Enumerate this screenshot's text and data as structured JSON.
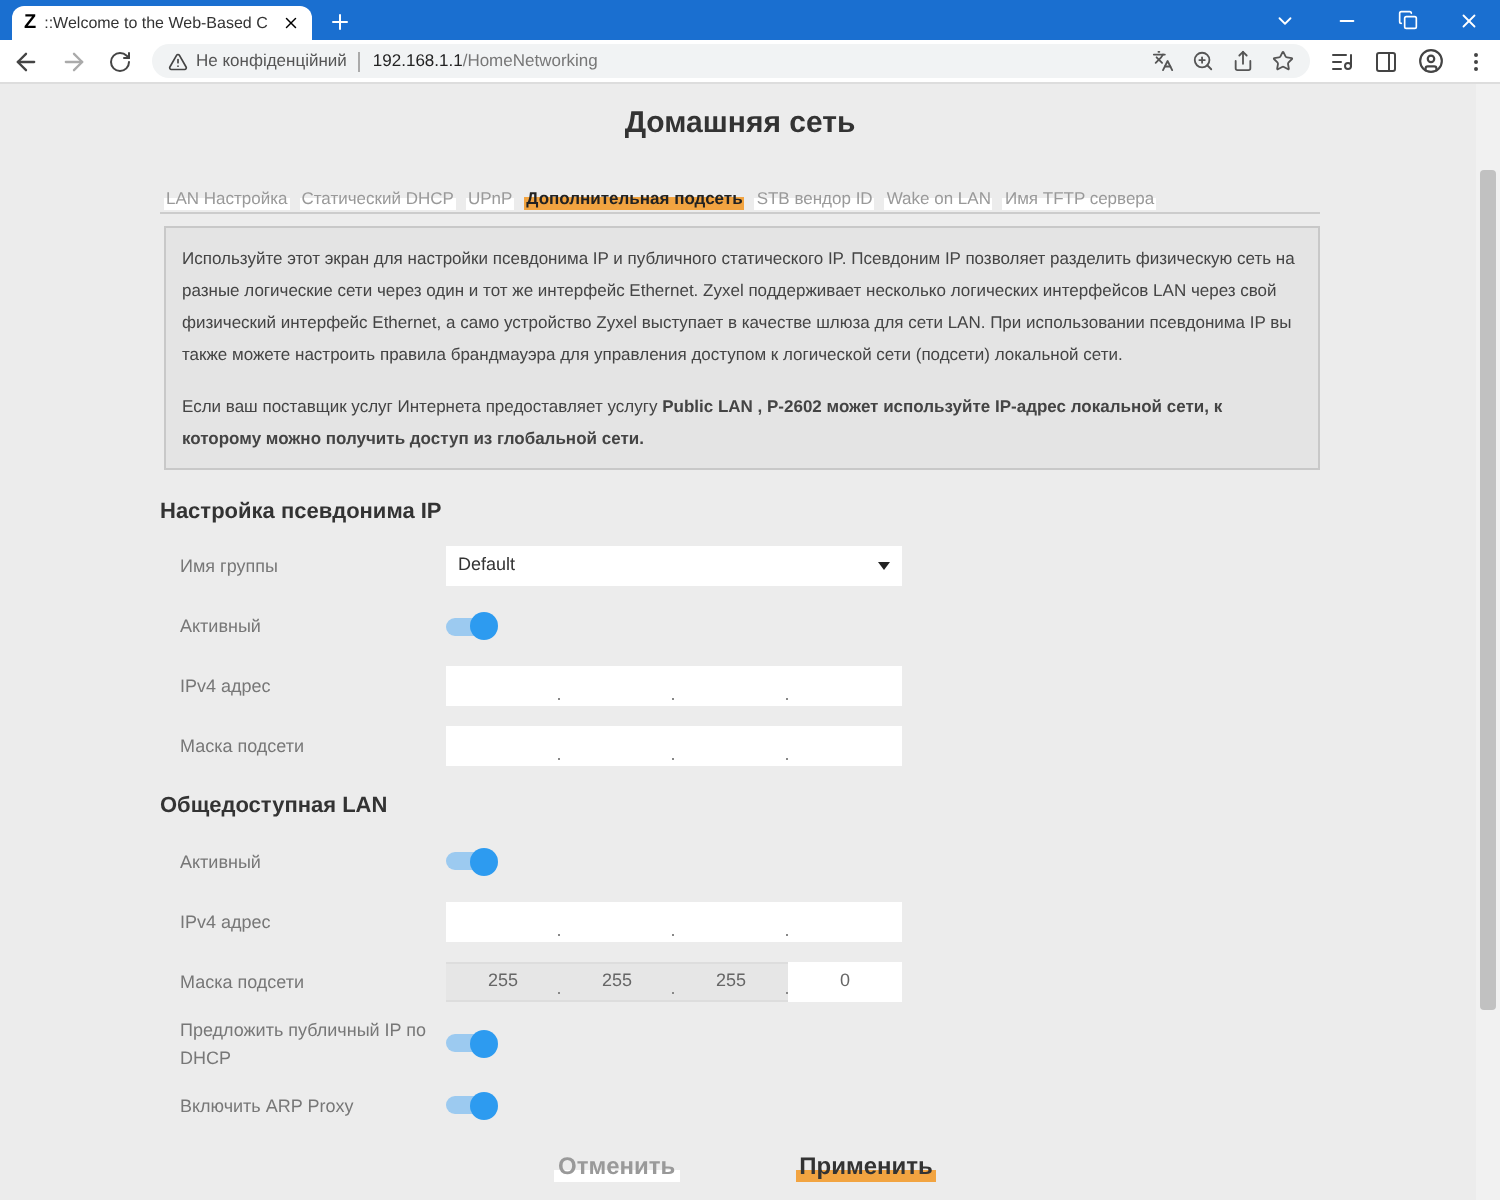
{
  "browser": {
    "tab": {
      "logo": "Z",
      "title": "::Welcome to the Web-Based C"
    },
    "security": "Не конфіденційний",
    "url_host": "192.168.1.1",
    "url_path": "/HomeNetworking"
  },
  "page_title": "Домашняя сеть",
  "tabs": [
    {
      "label": "LAN Настройка",
      "selected": false
    },
    {
      "label": "Статический DHCP",
      "selected": false
    },
    {
      "label": "UPnP",
      "selected": false
    },
    {
      "label": "Дополнительная подсеть",
      "selected": true
    },
    {
      "label": "STB вендор ID",
      "selected": false
    },
    {
      "label": "Wake on LAN",
      "selected": false
    },
    {
      "label": "Имя TFTP сервера",
      "selected": false
    }
  ],
  "info": [
    "Используйте этот экран для настройки псевдонима IP и публичного статического IP. Псевдоним IP позволяет разделить физическую сеть на разные логические сети через один и тот же интерфейс Ethernet. Zyxel поддерживает несколько логических интерфейсов LAN через свой физический интерфейс Ethernet, а само устройство Zyxel выступает в качестве шлюза для сети LAN. При использовании псевдонима IP вы также можете настроить правила брандмауэра для управления доступом к логической сети (подсети) локальной сети.",
    "Если ваш поставщик услуг Интернета предоставляет услугу **Public LAN , P-2602 может используйте IP-адрес локальной сети, к которому можно получить доступ из глобальной сети.**"
  ],
  "sections": [
    {
      "title": "Настройка псевдонима IP",
      "rows": [
        {
          "kind": "select",
          "label": "Имя группы",
          "value": "Default"
        },
        {
          "kind": "toggle",
          "label": "Активный",
          "on": true
        },
        {
          "kind": "ip",
          "label": "IPv4 адрес",
          "octets": [
            {
              "disabled": false
            },
            {
              "disabled": false
            },
            {
              "disabled": false
            },
            {
              "disabled": false
            }
          ]
        },
        {
          "kind": "ip",
          "label": "Маска подсети",
          "octets": [
            {
              "disabled": false
            },
            {
              "disabled": false
            },
            {
              "disabled": false
            },
            {
              "disabled": false
            }
          ]
        }
      ]
    },
    {
      "title": "Общедоступная LAN",
      "rows": [
        {
          "kind": "toggle",
          "label": "Активный",
          "on": true
        },
        {
          "kind": "ip",
          "label": "IPv4 адрес",
          "octets": [
            {
              "disabled": false
            },
            {
              "disabled": false
            },
            {
              "disabled": false
            },
            {
              "disabled": false
            }
          ]
        },
        {
          "kind": "ip",
          "label": "Маска подсети",
          "octets": [
            {
              "disabled": true,
              "value": "255"
            },
            {
              "disabled": true,
              "value": "255"
            },
            {
              "disabled": true,
              "value": "255"
            },
            {
              "disabled": false,
              "value": "0"
            }
          ]
        },
        {
          "kind": "toggle",
          "label": "Предложить публичный IP по DHCP",
          "on": true
        },
        {
          "kind": "toggle",
          "label": "Включить ARP Proxy",
          "on": true
        }
      ]
    }
  ],
  "buttons": [
    {
      "label": "Отменить",
      "kind": "secondary"
    },
    {
      "label": "Применить",
      "kind": "primary"
    }
  ]
}
